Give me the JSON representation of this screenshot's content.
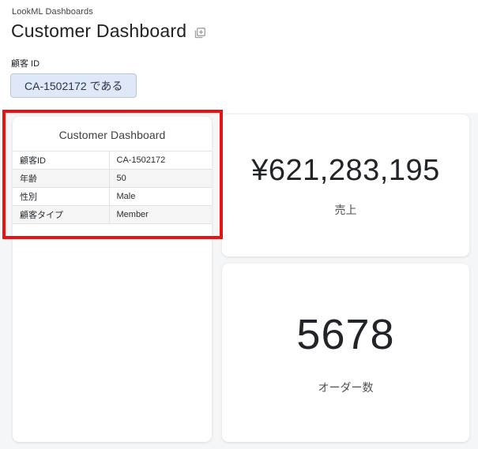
{
  "breadcrumb": "LookML Dashboards",
  "header": {
    "title": "Customer Dashboard",
    "title_icon": "copy-plus-icon"
  },
  "filter": {
    "label": "顧客 ID",
    "chip_value": "CA-1502172 である"
  },
  "tiles": {
    "customer": {
      "title": "Customer Dashboard",
      "rows": [
        {
          "label": "顧客ID",
          "value": "CA-1502172"
        },
        {
          "label": "年齢",
          "value": "50"
        },
        {
          "label": "性別",
          "value": "Male"
        },
        {
          "label": "顧客タイプ",
          "value": "Member"
        }
      ]
    },
    "sales": {
      "value": "¥621,283,195",
      "label": "売上"
    },
    "orders": {
      "value": "5678",
      "label": "オーダー数"
    }
  },
  "annotation": {
    "color": "#e81313",
    "purpose": "highlight-customer-tile"
  },
  "colors": {
    "chip_bg": "#dee8f6",
    "chip_border": "#b9c6da",
    "canvas_bg": "#f5f6f7",
    "stripe_bg": "#f5f5f5"
  }
}
